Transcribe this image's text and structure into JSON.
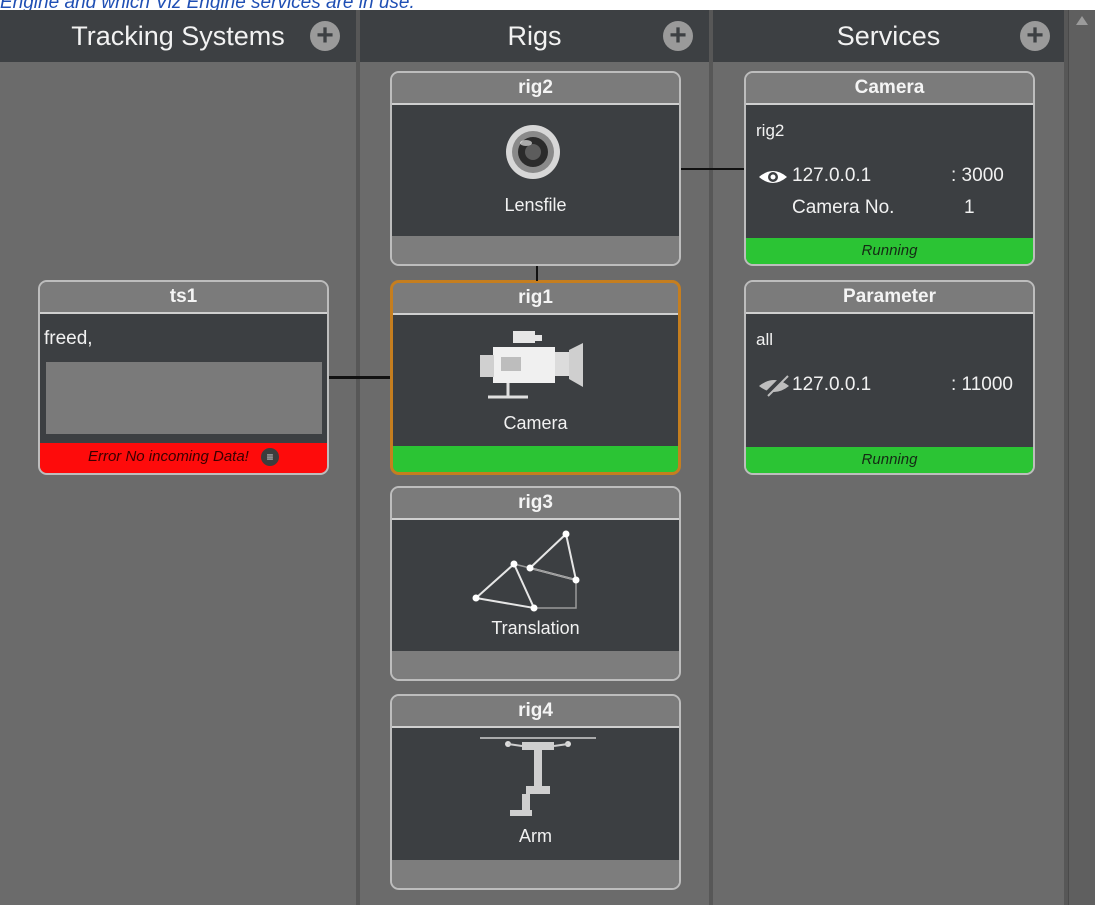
{
  "caption": "Engine and which Viz Engine services are in use.",
  "columns": {
    "tracking": {
      "label": "Tracking Systems"
    },
    "rigs": {
      "label": "Rigs"
    },
    "services": {
      "label": "Services"
    }
  },
  "tracking_systems": [
    {
      "name": "ts1",
      "info": "freed,",
      "status": "Error No incoming Data!",
      "status_color": "#fe0b0b"
    }
  ],
  "rigs": [
    {
      "name": "rig2",
      "type": "Lensfile",
      "icon": "lens-icon"
    },
    {
      "name": "rig1",
      "type": "Camera",
      "icon": "camera-icon",
      "selected": true,
      "status_color": "#2bc434"
    },
    {
      "name": "rig3",
      "type": "Translation",
      "icon": "translation-icon"
    },
    {
      "name": "rig4",
      "type": "Arm",
      "icon": "arm-icon"
    }
  ],
  "services": [
    {
      "name": "Camera",
      "rig": "rig2",
      "ip": "127.0.0.1",
      "port": ": 3000",
      "extra_label": "Camera No.",
      "extra_value": "1",
      "status": "Running",
      "icon": "eye-icon",
      "status_color": "#2bc434"
    },
    {
      "name": "Parameter",
      "rig": "all",
      "ip": "127.0.0.1",
      "port": ": 11000",
      "status": "Running",
      "icon": "eye-off-icon",
      "status_color": "#2bc434"
    }
  ],
  "colors": {
    "accent_selected": "#c57e1f",
    "panel_bg": "#3c3f42"
  }
}
